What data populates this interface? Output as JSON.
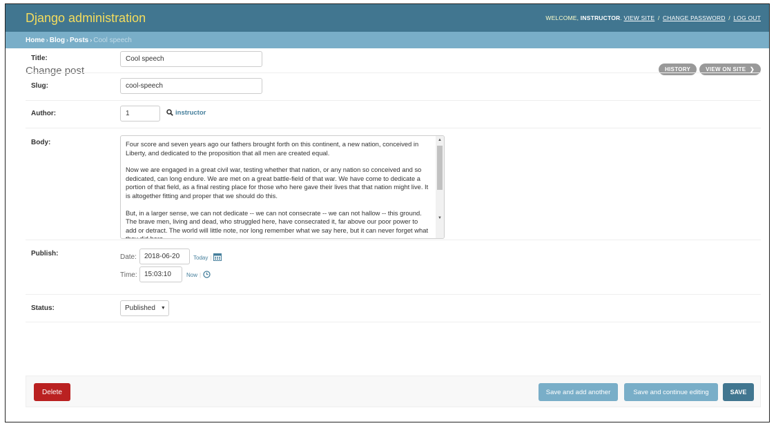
{
  "header": {
    "brand": "Django administration",
    "welcome": "Welcome,",
    "username": "instructor",
    "view_site": "View site",
    "change_password": "Change password",
    "log_out": "Log out",
    "separator": "/"
  },
  "breadcrumbs": {
    "items": [
      "Home",
      "Blog",
      "Posts"
    ],
    "current": "Cool speech",
    "separator": "›"
  },
  "page": {
    "title": "Change post",
    "history_label": "History",
    "view_on_site_label": "View on site",
    "view_on_site_arrow": "❯"
  },
  "form": {
    "title": {
      "label": "Title:",
      "value": "Cool speech"
    },
    "slug": {
      "label": "Slug:",
      "value": "cool-speech"
    },
    "author": {
      "label": "Author:",
      "value": "1",
      "lookup_name": "instructor",
      "lookup_icon": "search-icon"
    },
    "body": {
      "label": "Body:",
      "paragraphs": [
        "Four score and seven years ago our fathers brought forth on this continent, a new nation, conceived in Liberty, and dedicated to the proposition that all men are created equal.",
        "Now we are engaged in a great civil war, testing whether that nation, or any nation so conceived and so dedicated, can long endure. We are met on a great battle-field of that war. We have come to dedicate a portion of that field, as a final resting place for those who here gave their lives that that nation might live. It is altogether fitting and proper that we should do this.",
        "But, in a larger sense, we can not dedicate -- we can not consecrate -- we can not hallow -- this ground. The brave men, living and dead, who struggled here, have consecrated it, far above our poor power to add or detract. The world will little note, nor long remember what we say here, but it can never forget what they did here."
      ]
    },
    "publish": {
      "label": "Publish:",
      "date_label": "Date:",
      "date_value": "2018-06-20",
      "today_label": "Today",
      "time_label": "Time:",
      "time_value": "15:03:10",
      "now_label": "Now",
      "shortcut_separator": "|",
      "calendar_icon": "calendar-icon",
      "clock_icon": "clock-icon"
    },
    "status": {
      "label": "Status:",
      "value": "Published",
      "arrow": "▼"
    }
  },
  "actions": {
    "delete": "Delete",
    "save_add_another": "Save and add another",
    "save_continue": "Save and continue editing",
    "save": "Save"
  },
  "colors": {
    "header_bg": "#417690",
    "brand": "#f5dd5d",
    "breadcrumbs_bg": "#79aec8",
    "delete_bg": "#ba2121",
    "link": "#447e9b"
  }
}
